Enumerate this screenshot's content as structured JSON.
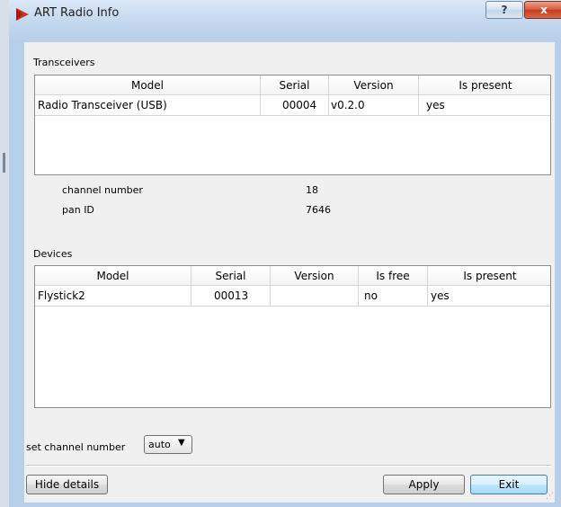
{
  "window": {
    "title": "ART Radio Info",
    "help_glyph": "?",
    "close_glyph": "x"
  },
  "transceivers": {
    "label": "Transceivers",
    "columns": [
      "Model",
      "Serial",
      "Version",
      "Is present"
    ],
    "rows": [
      [
        "Radio Transceiver (USB)",
        "00004",
        "v0.2.0",
        "yes"
      ]
    ],
    "channel_number_label": "channel number",
    "channel_number": "18",
    "pan_id_label": "pan ID",
    "pan_id": "7646"
  },
  "devices": {
    "label": "Devices",
    "columns": [
      "Model",
      "Serial",
      "Version",
      "Is free",
      "Is present"
    ],
    "rows": [
      [
        "Flystick2",
        "00013",
        "",
        "no",
        "yes"
      ]
    ]
  },
  "set_channel": {
    "label": "set channel number",
    "selected": "auto",
    "arrow": "▼"
  },
  "buttons": {
    "hide_details": "Hide details",
    "apply": "Apply",
    "exit": "Exit"
  },
  "colors": {
    "accent": "#c43b1d",
    "title_bar": "#b8cfe9",
    "client_bg": "#f0f0f0"
  }
}
